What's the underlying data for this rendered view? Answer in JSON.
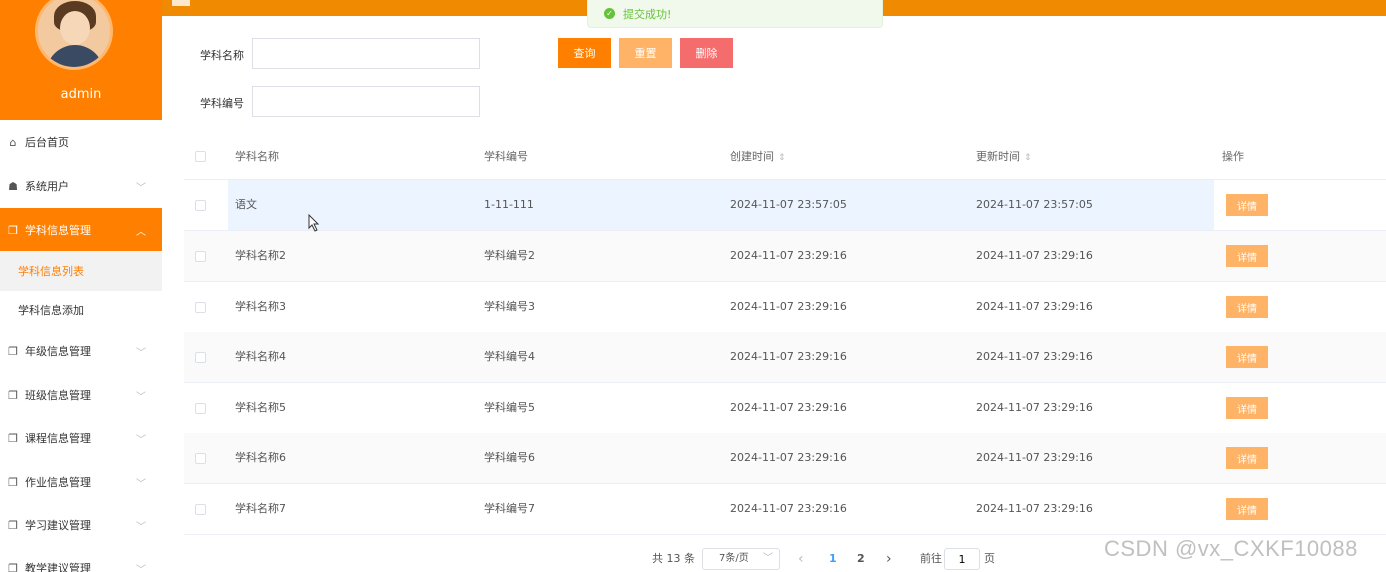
{
  "sidebar": {
    "username": "admin",
    "items": [
      {
        "label": "后台首页",
        "icon": "home-icon",
        "glyph": "⌂"
      },
      {
        "label": "系统用户",
        "icon": "user-icon",
        "glyph": "☗"
      },
      {
        "label": "学科信息管理",
        "icon": "folder-icon",
        "glyph": "❐"
      },
      {
        "label": "年级信息管理",
        "icon": "folder-icon",
        "glyph": "❐"
      },
      {
        "label": "班级信息管理",
        "icon": "folder-icon",
        "glyph": "❐"
      },
      {
        "label": "课程信息管理",
        "icon": "folder-icon",
        "glyph": "❐"
      },
      {
        "label": "作业信息管理",
        "icon": "folder-icon",
        "glyph": "❐"
      },
      {
        "label": "学习建议管理",
        "icon": "folder-icon",
        "glyph": "❐"
      },
      {
        "label": "教学建议管理",
        "icon": "folder-icon",
        "glyph": "❐"
      }
    ],
    "subitems": [
      "学科信息列表",
      "学科信息添加"
    ]
  },
  "toast": {
    "message": "提交成功!"
  },
  "search": {
    "name_label": "学科名称",
    "code_label": "学科编号",
    "name_value": "",
    "code_value": "",
    "query_label": "查询",
    "reset_label": "重置",
    "delete_label": "删除"
  },
  "table": {
    "columns": [
      "学科名称",
      "学科编号",
      "创建时间",
      "更新时间",
      "操作"
    ],
    "detail_label": "详情",
    "rows": [
      {
        "name": "语文",
        "code": "1-11-111",
        "created": "2024-11-07 23:57:05",
        "updated": "2024-11-07 23:57:05"
      },
      {
        "name": "学科名称2",
        "code": "学科编号2",
        "created": "2024-11-07 23:29:16",
        "updated": "2024-11-07 23:29:16"
      },
      {
        "name": "学科名称3",
        "code": "学科编号3",
        "created": "2024-11-07 23:29:16",
        "updated": "2024-11-07 23:29:16"
      },
      {
        "name": "学科名称4",
        "code": "学科编号4",
        "created": "2024-11-07 23:29:16",
        "updated": "2024-11-07 23:29:16"
      },
      {
        "name": "学科名称5",
        "code": "学科编号5",
        "created": "2024-11-07 23:29:16",
        "updated": "2024-11-07 23:29:16"
      },
      {
        "name": "学科名称6",
        "code": "学科编号6",
        "created": "2024-11-07 23:29:16",
        "updated": "2024-11-07 23:29:16"
      },
      {
        "name": "学科名称7",
        "code": "学科编号7",
        "created": "2024-11-07 23:29:16",
        "updated": "2024-11-07 23:29:16"
      }
    ]
  },
  "pagination": {
    "total": "共 13 条",
    "page_size": "7条/页",
    "prev": "‹",
    "pages": [
      "1",
      "2"
    ],
    "next": "›",
    "goto_label": "前往",
    "goto_value": "1",
    "page_suffix": "页"
  },
  "watermark": "CSDN @vx_CXKF10088",
  "colors": {
    "primary": "#ff7f00",
    "reset": "#ffb366",
    "delete": "#f56c6c",
    "success": "#67c23a"
  }
}
